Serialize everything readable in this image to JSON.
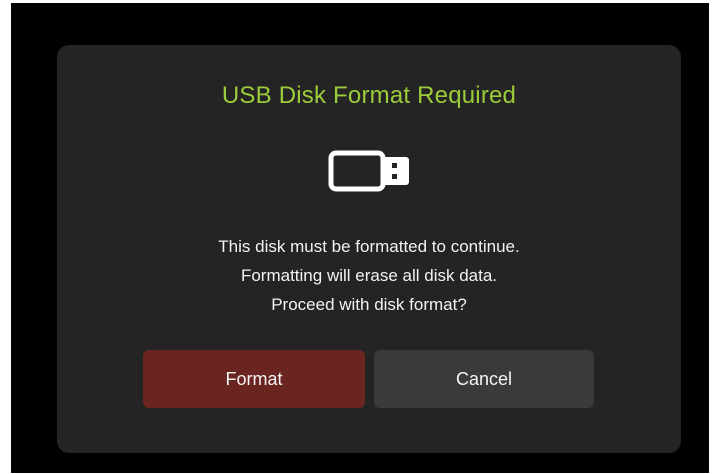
{
  "dialog": {
    "title": "USB Disk Format Required",
    "icon": "usb-drive-icon",
    "message_lines": [
      "This disk must be formatted to continue.",
      "Formatting will erase all disk data.",
      "Proceed with disk format?"
    ],
    "buttons": {
      "format_label": "Format",
      "cancel_label": "Cancel"
    }
  },
  "colors": {
    "title": "#9ccc3a",
    "dialog_background": "#242424",
    "format_button": "#6b2520",
    "cancel_button": "#3a3a3a"
  }
}
